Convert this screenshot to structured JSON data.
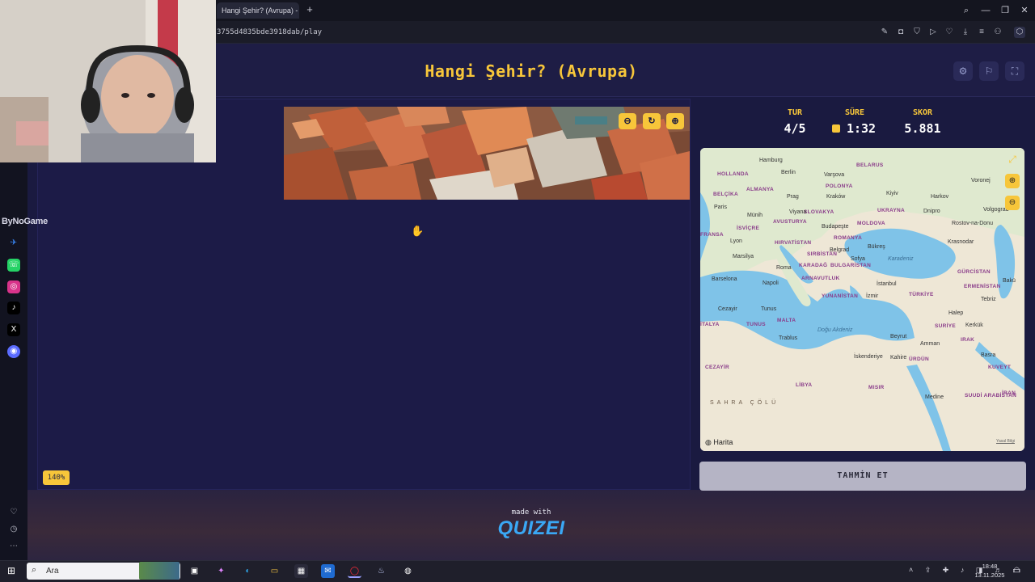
{
  "browser": {
    "tab_title": "Hangi Şehir? (Avrupa) - Q",
    "url": "3755d4835bde3918dab/play"
  },
  "game": {
    "title": "Hangi Şehir? (Avrupa)",
    "stats": [
      {
        "label": "TUR",
        "value": "4/5"
      },
      {
        "label": "SÜRE",
        "value": "1:32"
      },
      {
        "label": "SKOR",
        "value": "5.881"
      }
    ],
    "zoom_level": "140%",
    "guess_button": "TAHMİN ET",
    "made_with": "made with",
    "brand": "QUIZEI",
    "watermark": "ByNoGame"
  },
  "map": {
    "attribution": "Harita",
    "legal": "Yasal Bilgi",
    "cities": [
      {
        "name": "Hamburg"
      },
      {
        "name": "Berlin"
      },
      {
        "name": "Varşova"
      },
      {
        "name": "Paris"
      },
      {
        "name": "Prag"
      },
      {
        "name": "Kraków"
      },
      {
        "name": "Kiyiv"
      },
      {
        "name": "Harkov"
      },
      {
        "name": "Voronej"
      },
      {
        "name": "Münih"
      },
      {
        "name": "Dnipro"
      },
      {
        "name": "Volgograd"
      },
      {
        "name": "Rostov-na-Donu"
      },
      {
        "name": "Viyana"
      },
      {
        "name": "Budapeşte"
      },
      {
        "name": "Lyon"
      },
      {
        "name": "Bükreş"
      },
      {
        "name": "Krasnodar"
      },
      {
        "name": "Marsilya"
      },
      {
        "name": "Belgrad"
      },
      {
        "name": "Sofya"
      },
      {
        "name": "Roma"
      },
      {
        "name": "Barselona"
      },
      {
        "name": "Napoli"
      },
      {
        "name": "İstanbul"
      },
      {
        "name": "Bakü"
      },
      {
        "name": "Tebriz"
      },
      {
        "name": "İzmir"
      },
      {
        "name": "Cezayir"
      },
      {
        "name": "Tunus"
      },
      {
        "name": "Halep"
      },
      {
        "name": "Kerkük"
      },
      {
        "name": "Beyrut"
      },
      {
        "name": "Trablus"
      },
      {
        "name": "Amman"
      },
      {
        "name": "Basra"
      },
      {
        "name": "İskenderiye"
      },
      {
        "name": "Kahire"
      },
      {
        "name": "Medine"
      }
    ],
    "countries": [
      "HOLLANDA",
      "BELÇİKA",
      "ALMANYA",
      "POLONYA",
      "BELARUS",
      "UKRAYNA",
      "FRANSA",
      "İSVİÇRE",
      "AVUSTURYA",
      "SLOVAKYA",
      "MOLDOVA",
      "ROMANYA",
      "HIRVATİSTAN",
      "SIRBİSTAN",
      "BULGARİSTAN",
      "KARADAĞ",
      "ARNAVUTLUK",
      "YUNANİSTAN",
      "TÜRKİYE",
      "GÜRCİSTAN",
      "ERMENİSTAN",
      "SURİYE",
      "IRAK",
      "MALTA",
      "TUNUS",
      "CEZAYİR",
      "LİBYA",
      "MISIR",
      "SUUDİ ARABİSTAN",
      "KUVEYT",
      "İTALYA",
      "İRAN",
      "ÜRDÜN"
    ],
    "seas": [
      "Karadeniz",
      "Doğu Akdeniz",
      "SAHRA ÇÖLÜ"
    ]
  },
  "taskbar": {
    "search_placeholder": "Ara",
    "time": "18:48",
    "date": "13.11.2025"
  },
  "colors": {
    "accent": "#f7c63a",
    "background": "#1a1a40",
    "brand": "#3aa8f5"
  }
}
